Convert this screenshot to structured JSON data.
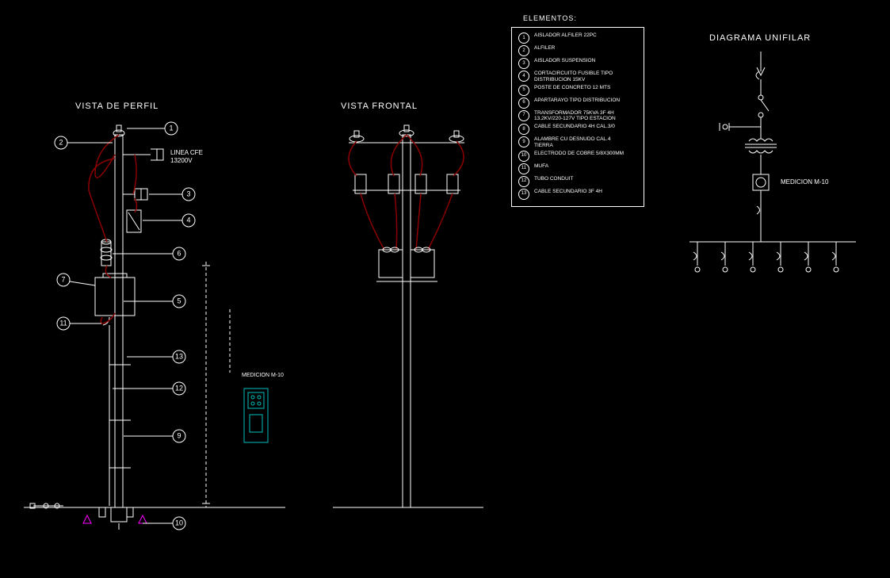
{
  "titles": {
    "perfil": "VISTA DE PERFIL",
    "frontal": "VISTA FRONTAL",
    "unifilar": "DIAGRAMA UNIFILAR",
    "elementos": "ELEMENTOS:"
  },
  "annotations": {
    "linea_cfe_1": "LINEA CFE",
    "linea_cfe_2": "13200V",
    "medicion": "MEDICION M-10",
    "medicion_unifilar": "MEDICION M-10"
  },
  "callouts": {
    "c1": "1",
    "c2": "2",
    "c3": "3",
    "c4": "4",
    "c5": "5",
    "c6": "6",
    "c7": "7",
    "c9": "9",
    "c10": "10",
    "c11": "11",
    "c12": "12",
    "c13": "13"
  },
  "legend": [
    {
      "num": "1",
      "text": "AISLADOR ALFILER 22PC"
    },
    {
      "num": "2",
      "text": "ALFILER"
    },
    {
      "num": "3",
      "text": "AISLADOR SUSPENSION"
    },
    {
      "num": "4",
      "text": "CORTACIRCUITO FUSIBLE TIPO DISTRIBUCION 15KV"
    },
    {
      "num": "5",
      "text": "POSTE DE CONCRETO 12 MTS"
    },
    {
      "num": "6",
      "text": "APARTARAYO TIPO DISTRIBUCION"
    },
    {
      "num": "7",
      "text": "TRANSFORMADOR 75KVA 3F 4H 13.2KV/220-127V TIPO ESTACION"
    },
    {
      "num": "8",
      "text": "CABLE SECUNDARIO 4H CAL.3/0"
    },
    {
      "num": "9",
      "text": "ALAMBRE CU DESNUDO CAL.4 TIERRA"
    },
    {
      "num": "10",
      "text": "ELECTRODO DE COBRE 5/8X300MM"
    },
    {
      "num": "11",
      "text": "MUFA"
    },
    {
      "num": "12",
      "text": "TUBO CONDUIT"
    },
    {
      "num": "13",
      "text": "CABLE SECUNDARIO 3F 4H"
    }
  ]
}
